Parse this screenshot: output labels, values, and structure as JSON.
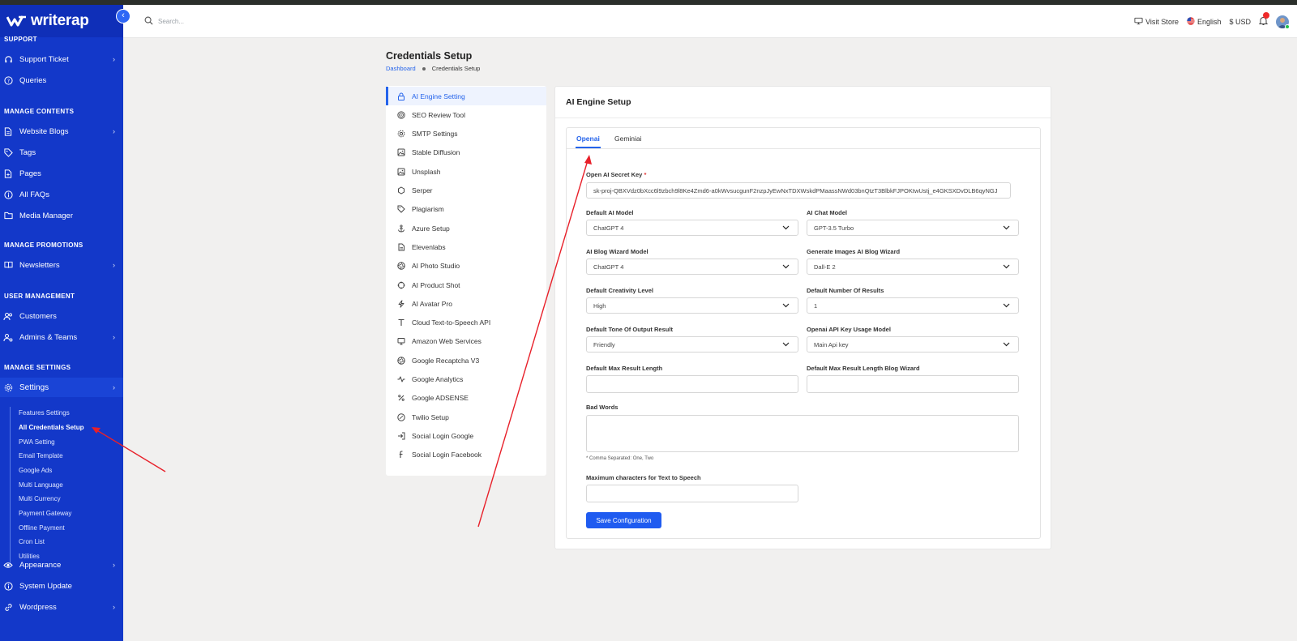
{
  "brand": {
    "name": "writerap"
  },
  "topbar": {
    "search_placeholder": "Search...",
    "visit_store": "Visit Store",
    "language": "English",
    "currency": "$ USD"
  },
  "sidebar": {
    "sections": {
      "support": "SUPPORT",
      "manage_contents": "MANAGE CONTENTS",
      "manage_promotions": "MANAGE PROMOTIONS",
      "user_management": "USER MANAGEMENT",
      "manage_settings": "MANAGE SETTINGS"
    },
    "items": {
      "support_ticket": "Support Ticket",
      "queries": "Queries",
      "website_blogs": "Website Blogs",
      "tags": "Tags",
      "pages": "Pages",
      "all_faqs": "All FAQs",
      "media_manager": "Media Manager",
      "newsletters": "Newsletters",
      "customers": "Customers",
      "admins_teams": "Admins & Teams",
      "settings": "Settings",
      "appearance": "Appearance",
      "system_update": "System Update",
      "wordpress": "Wordpress"
    },
    "settings_sub": [
      "Features Settings",
      "All Credentials Setup",
      "PWA Setting",
      "Email Template",
      "Google Ads",
      "Multi Language",
      "Multi Currency",
      "Payment Gateway",
      "Offline Payment",
      "Cron List",
      "Utilities"
    ]
  },
  "page": {
    "title": "Credentials Setup",
    "breadcrumb": [
      "Dashboard",
      "Credentials Setup"
    ]
  },
  "credential_menu": [
    {
      "label": "AI Engine Setting",
      "icon": "lock-icon"
    },
    {
      "label": "SEO Review Tool",
      "icon": "target-icon"
    },
    {
      "label": "SMTP Settings",
      "icon": "gear-icon"
    },
    {
      "label": "Stable Diffusion",
      "icon": "image-icon"
    },
    {
      "label": "Unsplash",
      "icon": "image-icon"
    },
    {
      "label": "Serper",
      "icon": "circle-icon"
    },
    {
      "label": "Plagiarism",
      "icon": "tag-icon"
    },
    {
      "label": "Azure Setup",
      "icon": "anchor-icon"
    },
    {
      "label": "Elevenlabs",
      "icon": "file-icon"
    },
    {
      "label": "AI Photo Studio",
      "icon": "aperture-icon"
    },
    {
      "label": "AI Product Shot",
      "icon": "crosshair-icon"
    },
    {
      "label": "AI Avatar Pro",
      "icon": "bolt-icon"
    },
    {
      "label": "Cloud Text-to-Speech API",
      "icon": "text-icon"
    },
    {
      "label": "Amazon Web Services",
      "icon": "monitor-icon"
    },
    {
      "label": "Google Recaptcha V3",
      "icon": "aperture-icon"
    },
    {
      "label": "Google Analytics",
      "icon": "activity-icon"
    },
    {
      "label": "Google ADSENSE",
      "icon": "percent-icon"
    },
    {
      "label": "Twilio Setup",
      "icon": "twilio-icon"
    },
    {
      "label": "Social Login Google",
      "icon": "login-icon"
    },
    {
      "label": "Social Login Facebook",
      "icon": "facebook-icon"
    }
  ],
  "card": {
    "title": "AI Engine Setup",
    "tabs": [
      "Openai",
      "Geminiai"
    ],
    "secret_key": {
      "label": "Open AI Secret Key",
      "value": "sk-proj-QBXVdz0bXcc6l9zbch9l8Ke4Zmd6-a0kWvsucgunF2nzpJyEwNxTDXWskdPMaassNWd03bnQtzT3BlbkFJPOKtwUstj_e4GKSXDvDLB6qyNGJ"
    },
    "fields": {
      "default_ai_model": {
        "label": "Default AI Model",
        "value": "ChatGPT 4"
      },
      "ai_chat_model": {
        "label": "AI Chat Model",
        "value": "GPT-3.5 Turbo"
      },
      "ai_blog_wizard_model": {
        "label": "AI Blog Wizard Model",
        "value": "ChatGPT 4"
      },
      "generate_images_ai_blog_wizard": {
        "label": "Generate Images AI Blog Wizard",
        "value": "Dall-E 2"
      },
      "default_creativity_level": {
        "label": "Default Creativity Level",
        "value": "High"
      },
      "default_number_of_results": {
        "label": "Default Number Of Results",
        "value": "1"
      },
      "default_tone": {
        "label": "Default Tone Of Output Result",
        "value": "Friendly"
      },
      "openai_api_key_usage_model": {
        "label": "Openai API Key Usage Model",
        "value": "Main Api key"
      },
      "default_max_result_length": {
        "label": "Default Max Result Length",
        "value": ""
      },
      "default_max_result_length_blog": {
        "label": "Default Max Result Length Blog Wizard",
        "value": ""
      },
      "bad_words": {
        "label": "Bad Words",
        "value": "",
        "hint": "* Comma Separated: One, Two"
      },
      "max_chars_tts": {
        "label": "Maximum characters for Text to Speech",
        "value": ""
      }
    },
    "save_label": "Save Configuration"
  },
  "colors": {
    "sidebar": "#1338c9",
    "accent": "#2463eb",
    "annotation_arrow": "#e8202a"
  }
}
